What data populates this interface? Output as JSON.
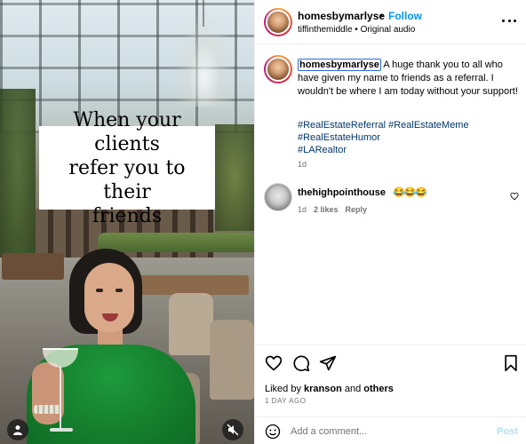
{
  "media": {
    "caption_text": "When your clients\nrefer you to their\nfriends"
  },
  "header": {
    "username": "homesbymarlyse",
    "dot": "•",
    "follow_label": "Follow",
    "subtitle": "tiffinthemiddle • Original audio"
  },
  "caption": {
    "username": "homesbymarlyse",
    "text": " A huge thank you to all who have given my name to friends as a referral. I wouldn't be where I am today without your support!",
    "hashtags": [
      "#RealEstateReferral #RealEstateMeme",
      "#RealEstateHumor",
      "#LARealtor"
    ],
    "time": "1d"
  },
  "comment": {
    "username": "thehighpointhouse",
    "text": "😂😂😂",
    "time": "1d",
    "likes": "2 likes",
    "reply_label": "Reply"
  },
  "actions": {
    "liked_prefix": "Liked by ",
    "liked_user": "kranson",
    "liked_and": " and ",
    "liked_others": "others",
    "ago": "1 DAY AGO"
  },
  "add_comment": {
    "placeholder": "Add a comment...",
    "post_label": "Post"
  },
  "icons": {
    "like": "heart-icon",
    "comment": "comment-icon",
    "share": "paper-plane-icon",
    "save": "bookmark-icon",
    "emoji": "smiley-icon",
    "more": "more-dots-icon",
    "user_tag": "person-icon",
    "mute": "speaker-muted-icon"
  },
  "colors": {
    "link_blue": "#0095f6",
    "hashtag": "#00376b",
    "muted_text": "#737373",
    "post_disabled": "#b2dffc"
  }
}
